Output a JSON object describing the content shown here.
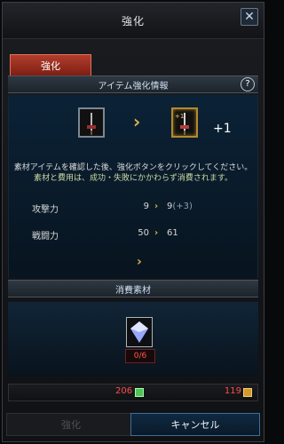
{
  "window": {
    "title": "強化"
  },
  "tab": {
    "label": "強化"
  },
  "info": {
    "header": "アイテム強化情報",
    "help": "?",
    "enhancement": "+1",
    "line1": "素材アイテムを確認した後、強化ボタンをクリックしてください。",
    "line2": "素材と費用は、成功・失敗にかかわらず消費されます。"
  },
  "stats": [
    {
      "label": "攻撃力",
      "old": "9",
      "new": "9",
      "bonus": "(+3)"
    },
    {
      "label": "戦闘力",
      "old": "50",
      "new": "61"
    }
  ],
  "materials": {
    "header": "消費素材",
    "count": "0/6"
  },
  "currency": {
    "left": "206",
    "right": "119"
  },
  "buttons": {
    "enhance": "強化",
    "cancel": "キャンセル"
  },
  "colors": {
    "accent": "#b13e2c",
    "highlight": "#d8b24c",
    "warning": "#ff4c4c"
  }
}
